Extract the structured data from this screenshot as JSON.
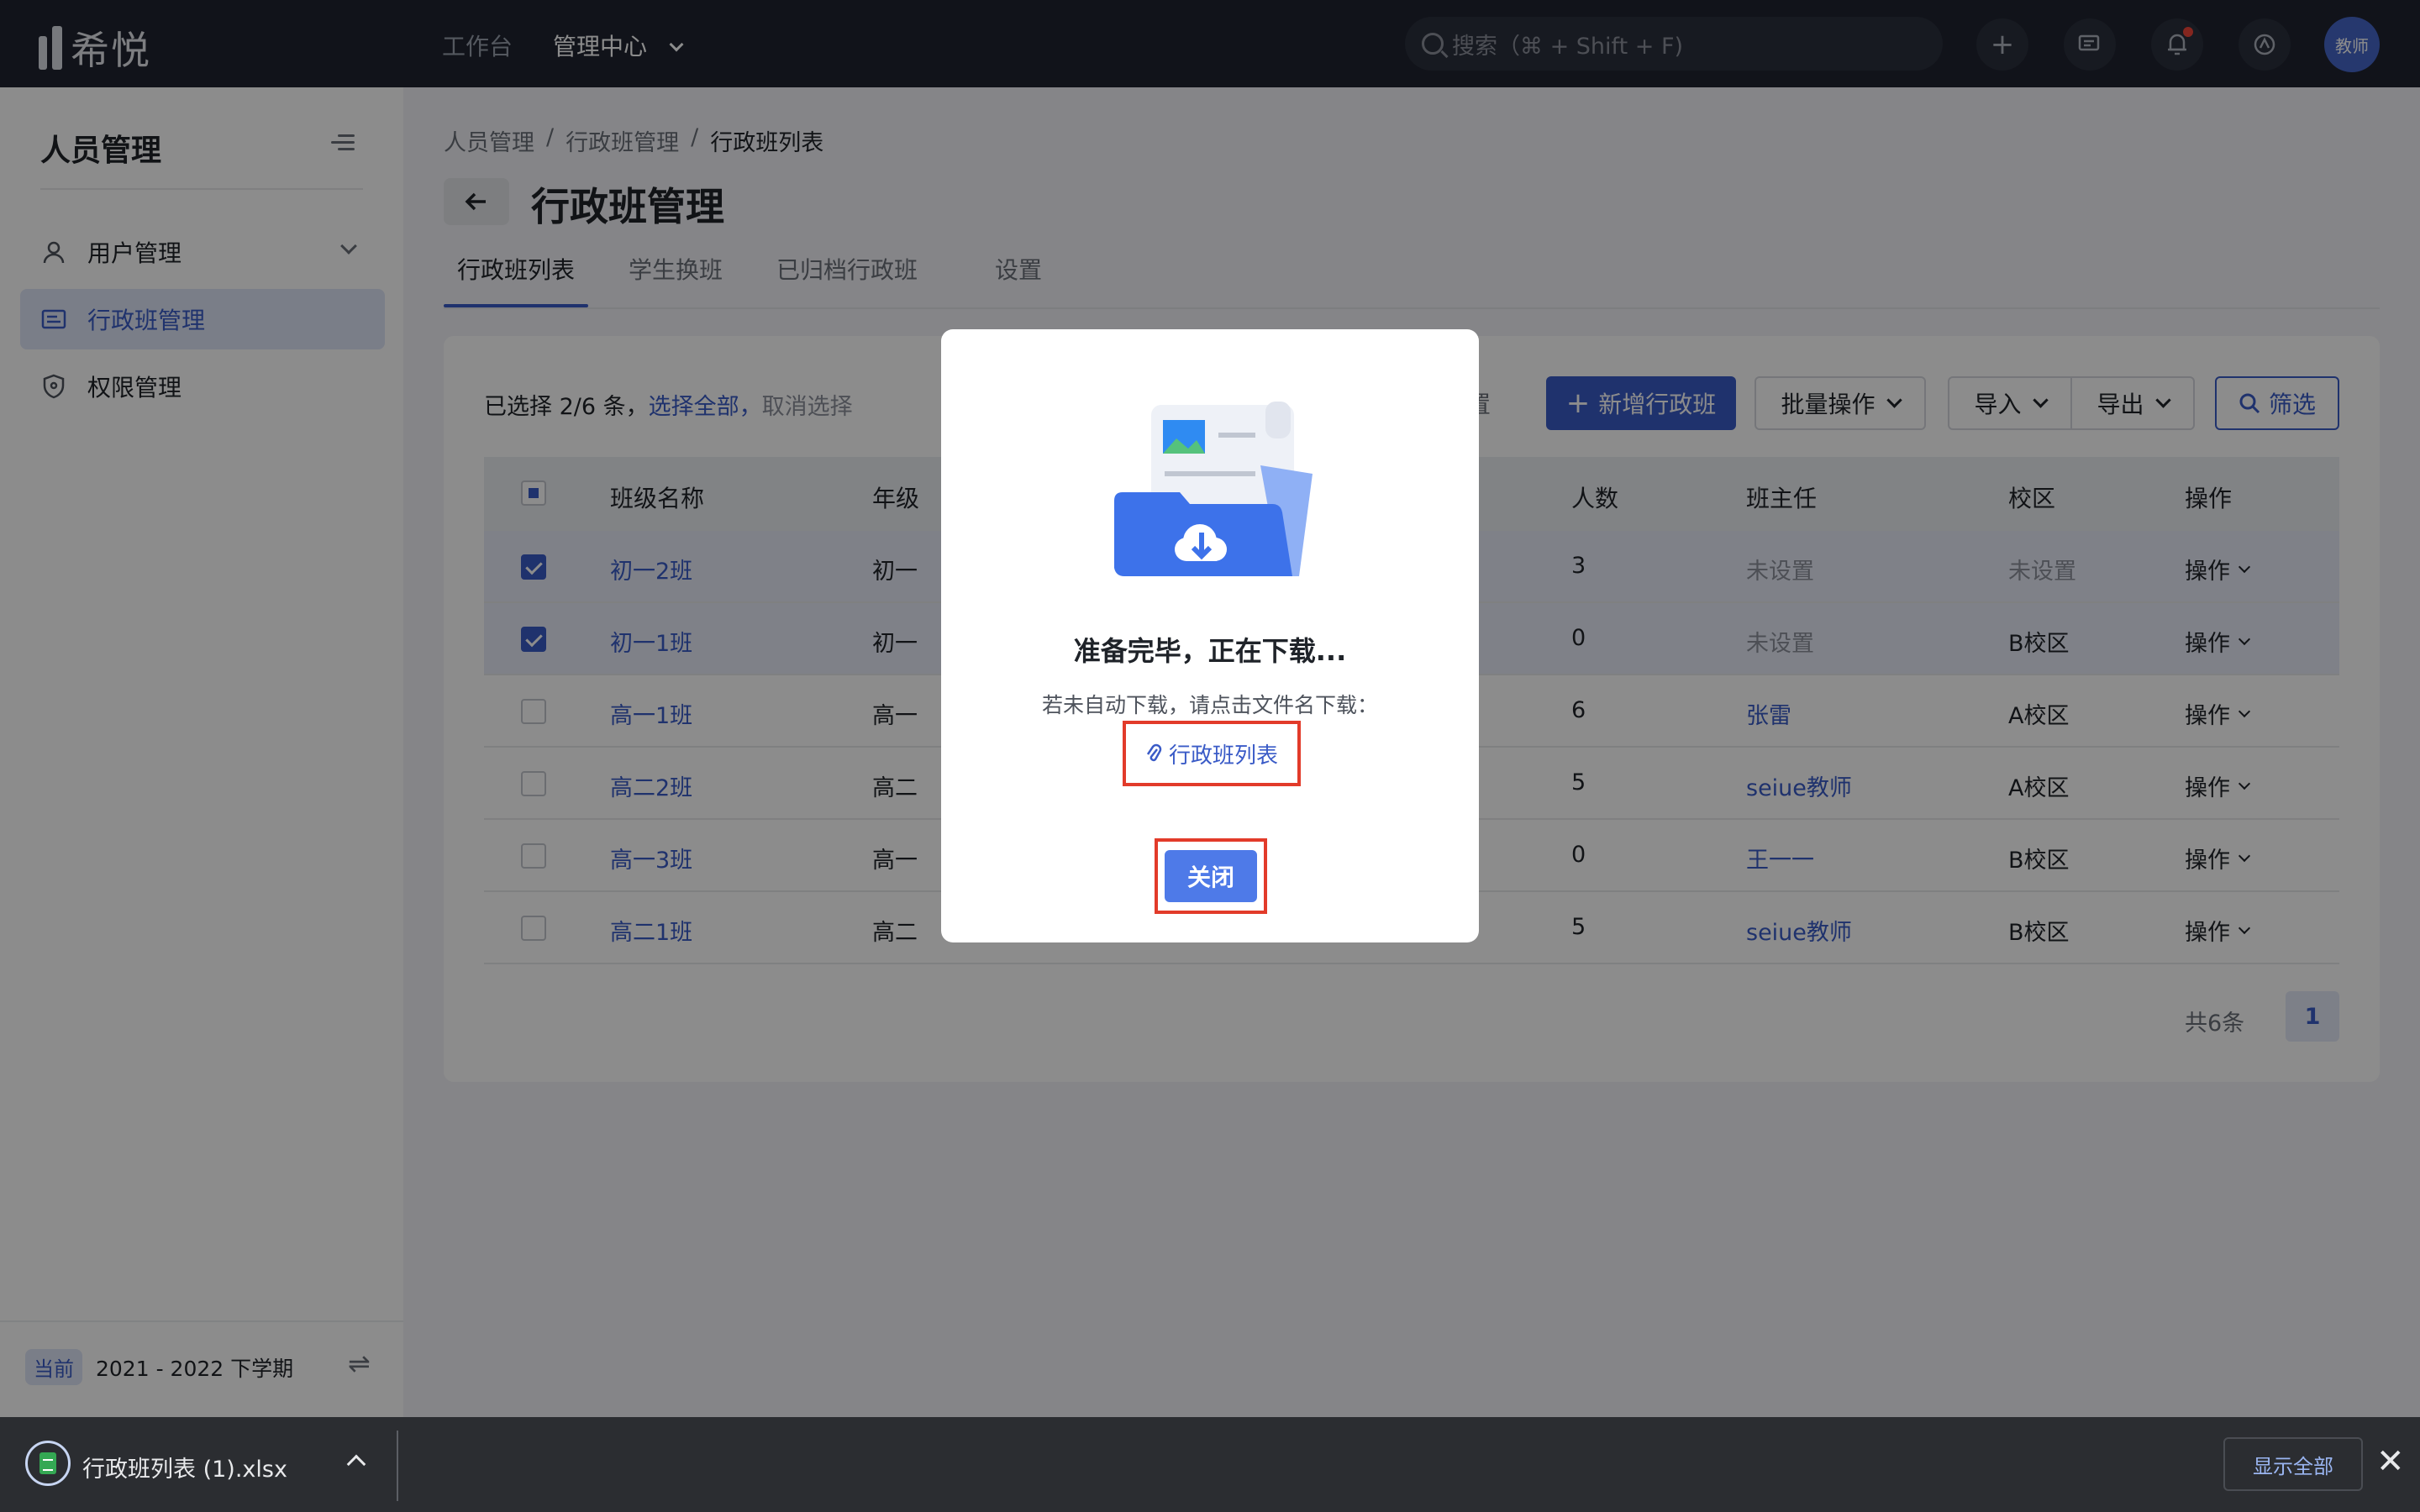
{
  "topbar": {
    "logo_text": "希悦",
    "nav": [
      "工作台",
      "管理中心"
    ],
    "search_placeholder": "搜索（⌘ + Shift + F)",
    "avatar_text": "教师"
  },
  "sidebar": {
    "title": "人员管理",
    "items": [
      {
        "label": "用户管理",
        "icon": "user-icon"
      },
      {
        "label": "行政班管理",
        "icon": "class-list-icon"
      },
      {
        "label": "权限管理",
        "icon": "shield-icon"
      }
    ],
    "term_badge": "当前",
    "term": "2021 - 2022 下学期"
  },
  "breadcrumb": [
    "人员管理",
    "/",
    "行政班管理",
    "/",
    "行政班列表"
  ],
  "page_title": "行政班管理",
  "tabs": [
    "行政班列表",
    "学生换班",
    "已归档行政班",
    "设置"
  ],
  "toolbar": {
    "selected_prefix": "已选择 2/6 条，",
    "select_all": "选择全部，",
    "deselect": "取消选择",
    "partial_hidden": "置",
    "add_class": "新增行政班",
    "batch": "批量操作",
    "import": "导入",
    "export": "导出",
    "filter": "筛选"
  },
  "table": {
    "headers": [
      "班级名称",
      "年级",
      "人数",
      "班主任",
      "校区",
      "操作"
    ],
    "rows": [
      {
        "name": "初一2班",
        "grade": "初一",
        "count": "3",
        "teacher": "未设置",
        "campus": "未设置",
        "op": "操作",
        "checked": true,
        "teacher_link": false
      },
      {
        "name": "初一1班",
        "grade": "初一",
        "count": "0",
        "teacher": "未设置",
        "campus": "B校区",
        "op": "操作",
        "checked": true,
        "teacher_link": false
      },
      {
        "name": "高一1班",
        "grade": "高一",
        "count": "6",
        "teacher": "张雷",
        "campus": "A校区",
        "op": "操作",
        "checked": false,
        "teacher_link": true
      },
      {
        "name": "高二2班",
        "grade": "高二",
        "count": "5",
        "teacher": "seiue教师",
        "campus": "A校区",
        "op": "操作",
        "checked": false,
        "teacher_link": true
      },
      {
        "name": "高一3班",
        "grade": "高一",
        "count": "0",
        "teacher": "王一一",
        "campus": "B校区",
        "op": "操作",
        "checked": false,
        "teacher_link": true
      },
      {
        "name": "高二1班",
        "grade": "高二",
        "count": "5",
        "teacher": "seiue教师",
        "campus": "B校区",
        "op": "操作",
        "checked": false,
        "teacher_link": true
      }
    ]
  },
  "pager": {
    "total": "共6条",
    "page": "1"
  },
  "modal": {
    "title": "准备完毕，正在下载...",
    "desc": "若未自动下载，请点击文件名下载：",
    "file_link": "行政班列表",
    "close": "关闭"
  },
  "download_bar": {
    "file_name": "行政班列表 (1).xlsx",
    "show_all": "显示全部"
  },
  "colors": {
    "accent": "#3a5bc7",
    "topbar": "#1f2330",
    "highlight_box": "#e23b2a"
  }
}
